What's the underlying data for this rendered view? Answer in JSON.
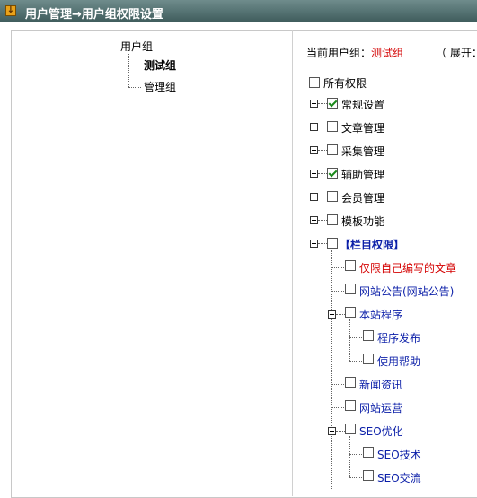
{
  "title": "用户管理→用户组权限设置",
  "left_tree": {
    "root": "用户组",
    "items": [
      {
        "label": "测试组",
        "selected": true
      },
      {
        "label": "管理组",
        "selected": false
      }
    ]
  },
  "right_panel": {
    "current_group_label": "当前用户组：",
    "current_group": "测试组",
    "expand_label": "（ 展开："
  },
  "perm_tree": {
    "root": "所有权限",
    "sections": [
      {
        "label": "常规设置",
        "checked": true
      },
      {
        "label": "文章管理",
        "checked": false
      },
      {
        "label": "采集管理",
        "checked": false
      },
      {
        "label": "辅助管理",
        "checked": true
      },
      {
        "label": "会员管理",
        "checked": false
      },
      {
        "label": "模板功能",
        "checked": false
      }
    ],
    "column_section": "【栏目权限】",
    "column_items": [
      {
        "label": "仅限自己编写的文章",
        "color": "red"
      },
      {
        "label": "网站公告(网站公告)",
        "color": "blue"
      },
      {
        "label": "本站程序",
        "color": "blue"
      },
      {
        "label": "程序发布",
        "color": "blue"
      },
      {
        "label": "使用帮助",
        "color": "blue"
      },
      {
        "label": "新闻资讯",
        "color": "blue"
      },
      {
        "label": "网站运营",
        "color": "blue"
      },
      {
        "label": "SEO优化",
        "color": "blue"
      },
      {
        "label": "SEO技术",
        "color": "blue"
      },
      {
        "label": "SEO交流",
        "color": "blue"
      }
    ]
  },
  "colors": {
    "accent_red": "#d40000",
    "link_blue": "#0b1fa8",
    "check_green": "#1a8a1a",
    "titlebar": "#4f6c6c"
  },
  "icons": {
    "title_icon": "down-arrow-icon"
  }
}
